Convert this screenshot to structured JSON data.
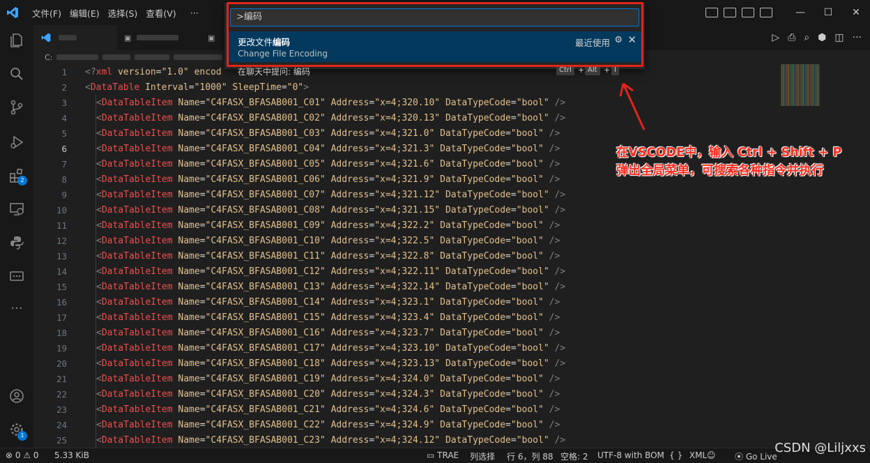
{
  "menu": [
    "文件(F)",
    "编辑(E)",
    "选择(S)",
    "查看(V)",
    "···"
  ],
  "breadcrumb_drive": "C:",
  "command_palette": {
    "input_value": ">编码",
    "item_title_prefix": "更改文件",
    "item_title_bold": "编码",
    "item_subtitle": "Change File Encoding",
    "item_recent": "最近使用",
    "second_item": "在聊天中提问: 编码",
    "shortcut": [
      "Ctrl",
      "Alt",
      "I"
    ]
  },
  "annotation": [
    "在VSCODE中，输入 Ctrl + Shift + P",
    "弹出全局菜单，可搜索各种指令并执行"
  ],
  "editor": {
    "line1": {
      "ln": "1",
      "open": "<?",
      "tag": "xml",
      "attr": "version",
      "val": "\"1.0\"",
      "tail": "encod"
    },
    "line2": {
      "ln": "2",
      "tag": "DataTable",
      "a1": "Interval",
      "v1": "\"1000\"",
      "a2": "SleepTime",
      "v2": "\"0\"",
      "close": ">"
    },
    "item_tag": "DataTableItem",
    "attr_name": "Name",
    "attr_address": "Address",
    "attr_type": "DataTypeCode",
    "type_value": "\"bool\"",
    "rows": [
      {
        "ln": "3",
        "name": "\"C4FASX_BFASAB001_C01\"",
        "addr": "\"x=4;320.10\""
      },
      {
        "ln": "4",
        "name": "\"C4FASX_BFASAB001_C02\"",
        "addr": "\"x=4;320.13\""
      },
      {
        "ln": "5",
        "name": "\"C4FASX_BFASAB001_C03\"",
        "addr": "\"x=4;321.0\""
      },
      {
        "ln": "6",
        "name": "\"C4FASX_BFASAB001_C04\"",
        "addr": "\"x=4;321.3\""
      },
      {
        "ln": "7",
        "name": "\"C4FASX_BFASAB001_C05\"",
        "addr": "\"x=4;321.6\""
      },
      {
        "ln": "8",
        "name": "\"C4FASX_BFASAB001_C06\"",
        "addr": "\"x=4;321.9\""
      },
      {
        "ln": "9",
        "name": "\"C4FASX_BFASAB001_C07\"",
        "addr": "\"x=4;321.12\""
      },
      {
        "ln": "10",
        "name": "\"C4FASX_BFASAB001_C08\"",
        "addr": "\"x=4;321.15\""
      },
      {
        "ln": "11",
        "name": "\"C4FASX_BFASAB001_C09\"",
        "addr": "\"x=4;322.2\""
      },
      {
        "ln": "12",
        "name": "\"C4FASX_BFASAB001_C10\"",
        "addr": "\"x=4;322.5\""
      },
      {
        "ln": "13",
        "name": "\"C4FASX_BFASAB001_C11\"",
        "addr": "\"x=4;322.8\""
      },
      {
        "ln": "14",
        "name": "\"C4FASX_BFASAB001_C12\"",
        "addr": "\"x=4;322.11\""
      },
      {
        "ln": "15",
        "name": "\"C4FASX_BFASAB001_C13\"",
        "addr": "\"x=4;322.14\""
      },
      {
        "ln": "16",
        "name": "\"C4FASX_BFASAB001_C14\"",
        "addr": "\"x=4;323.1\""
      },
      {
        "ln": "17",
        "name": "\"C4FASX_BFASAB001_C15\"",
        "addr": "\"x=4;323.4\""
      },
      {
        "ln": "18",
        "name": "\"C4FASX_BFASAB001_C16\"",
        "addr": "\"x=4;323.7\""
      },
      {
        "ln": "19",
        "name": "\"C4FASX_BFASAB001_C17\"",
        "addr": "\"x=4;323.10\""
      },
      {
        "ln": "20",
        "name": "\"C4FASX_BFASAB001_C18\"",
        "addr": "\"x=4;323.13\""
      },
      {
        "ln": "21",
        "name": "\"C4FASX_BFASAB001_C19\"",
        "addr": "\"x=4;324.0\""
      },
      {
        "ln": "22",
        "name": "\"C4FASX_BFASAB001_C20\"",
        "addr": "\"x=4;324.3\""
      },
      {
        "ln": "23",
        "name": "\"C4FASX_BFASAB001_C21\"",
        "addr": "\"x=4;324.6\""
      },
      {
        "ln": "24",
        "name": "\"C4FASX_BFASAB001_C22\"",
        "addr": "\"x=4;324.9\""
      },
      {
        "ln": "25",
        "name": "\"C4FASX_BFASAB001_C23\"",
        "addr": "\"x=4;324.12\""
      }
    ]
  },
  "activity_badges": {
    "extensions": "2",
    "settings": "1"
  },
  "statusbar": {
    "errors": "0",
    "warnings": "0",
    "filesize": "5.33 KiB",
    "trae": "TRAE",
    "mode": "列选择",
    "position": "行 6，列 88",
    "spaces": "空格: 2",
    "encoding": "UTF-8 with BOM",
    "language_brace": "{ }",
    "language": "XML",
    "golive": "Go Live"
  },
  "watermark": "CSDN @Liljxxs"
}
